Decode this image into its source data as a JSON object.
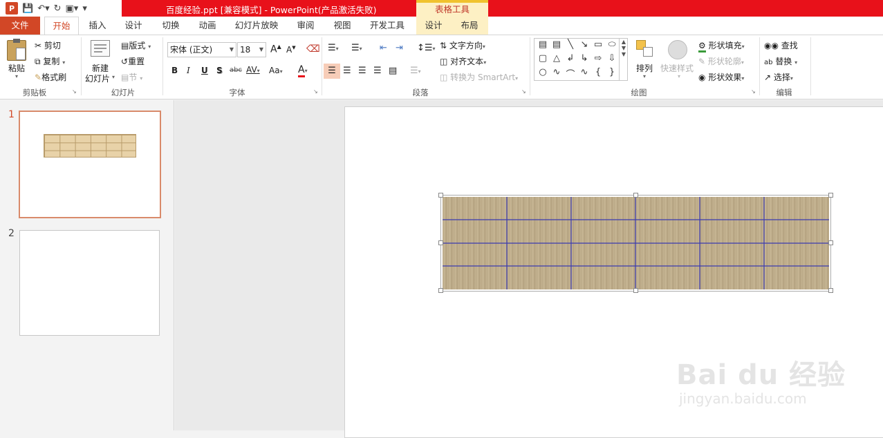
{
  "window": {
    "title": "百度经验.ppt [兼容模式] -   PowerPoint(产品激活失败)",
    "context_group": "表格工具"
  },
  "tabs": {
    "file": "文件",
    "home": "开始",
    "insert": "插入",
    "design": "设计",
    "transitions": "切换",
    "animations": "动画",
    "slideshow": "幻灯片放映",
    "review": "审阅",
    "view": "视图",
    "developer": "开发工具",
    "ctx_design": "设计",
    "ctx_layout": "布局"
  },
  "clipboard": {
    "paste": "粘贴",
    "cut": "剪切",
    "copy": "复制",
    "format_painter": "格式刷",
    "label": "剪贴板"
  },
  "slides_group": {
    "new_slide_line1": "新建",
    "new_slide_line2": "幻灯片",
    "layout": "版式",
    "reset": "重置",
    "section": "节",
    "label": "幻灯片"
  },
  "font": {
    "name": "宋体 (正文)",
    "size": "18",
    "label": "字体",
    "bold": "B",
    "italic": "I",
    "underline": "U",
    "shadow": "S",
    "strike": "abc",
    "spacing": "AV",
    "case": "Aa",
    "grow": "A",
    "shrink": "A",
    "color": "A"
  },
  "paragraph": {
    "text_direction": "文字方向",
    "align_text": "对齐文本",
    "smartart": "转换为 SmartArt",
    "label": "段落"
  },
  "drawing": {
    "arrange": "排列",
    "quick_styles": "快速样式",
    "fill": "形状填充",
    "outline": "形状轮廓",
    "effects": "形状效果",
    "label": "绘图"
  },
  "editing": {
    "find": "查找",
    "replace": "替换",
    "select": "选择",
    "label": "编辑"
  },
  "slides": [
    {
      "number": "1"
    },
    {
      "number": "2"
    }
  ],
  "watermark": {
    "logo": "Bai du 经验",
    "url": "jingyan.baidu.com"
  },
  "colors": {
    "accent": "#d24726",
    "title_bar": "#e8111a",
    "table_grid": "#3a3ab0"
  }
}
